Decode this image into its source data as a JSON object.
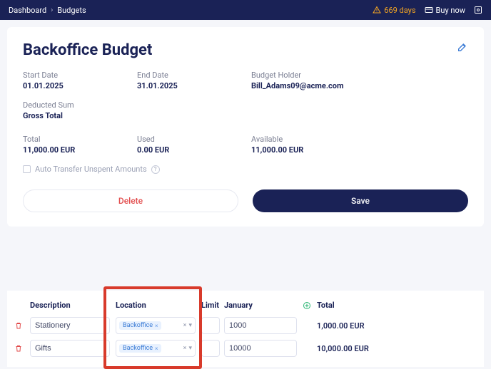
{
  "topbar": {
    "crumb1": "Dashboard",
    "crumb2": "Budgets",
    "days_warn": "669 days",
    "buy_now": "Buy now"
  },
  "card": {
    "title": "Backoffice Budget",
    "start_date_label": "Start Date",
    "start_date": "01.01.2025",
    "end_date_label": "End Date",
    "end_date": "31.01.2025",
    "holder_label": "Budget Holder",
    "holder": "Bill_Adams09@acme.com",
    "deducted_label": "Deducted Sum",
    "deducted": "Gross Total",
    "total_label": "Total",
    "total": "11,000.00 EUR",
    "used_label": "Used",
    "used": "0.00 EUR",
    "available_label": "Available",
    "available": "11,000.00 EUR",
    "auto_transfer": "Auto Transfer Unspent Amounts",
    "delete": "Delete",
    "save": "Save"
  },
  "items": {
    "head_description": "Description",
    "head_location": "Location",
    "head_limit": "Limit",
    "head_month": "January",
    "head_total": "Total",
    "rows": [
      {
        "desc": "Stationery",
        "location": "Backoffice",
        "month": "1000",
        "total": "1,000.00 EUR"
      },
      {
        "desc": "Gifts",
        "location": "Backoffice",
        "month": "10000",
        "total": "10,000.00 EUR"
      }
    ]
  }
}
